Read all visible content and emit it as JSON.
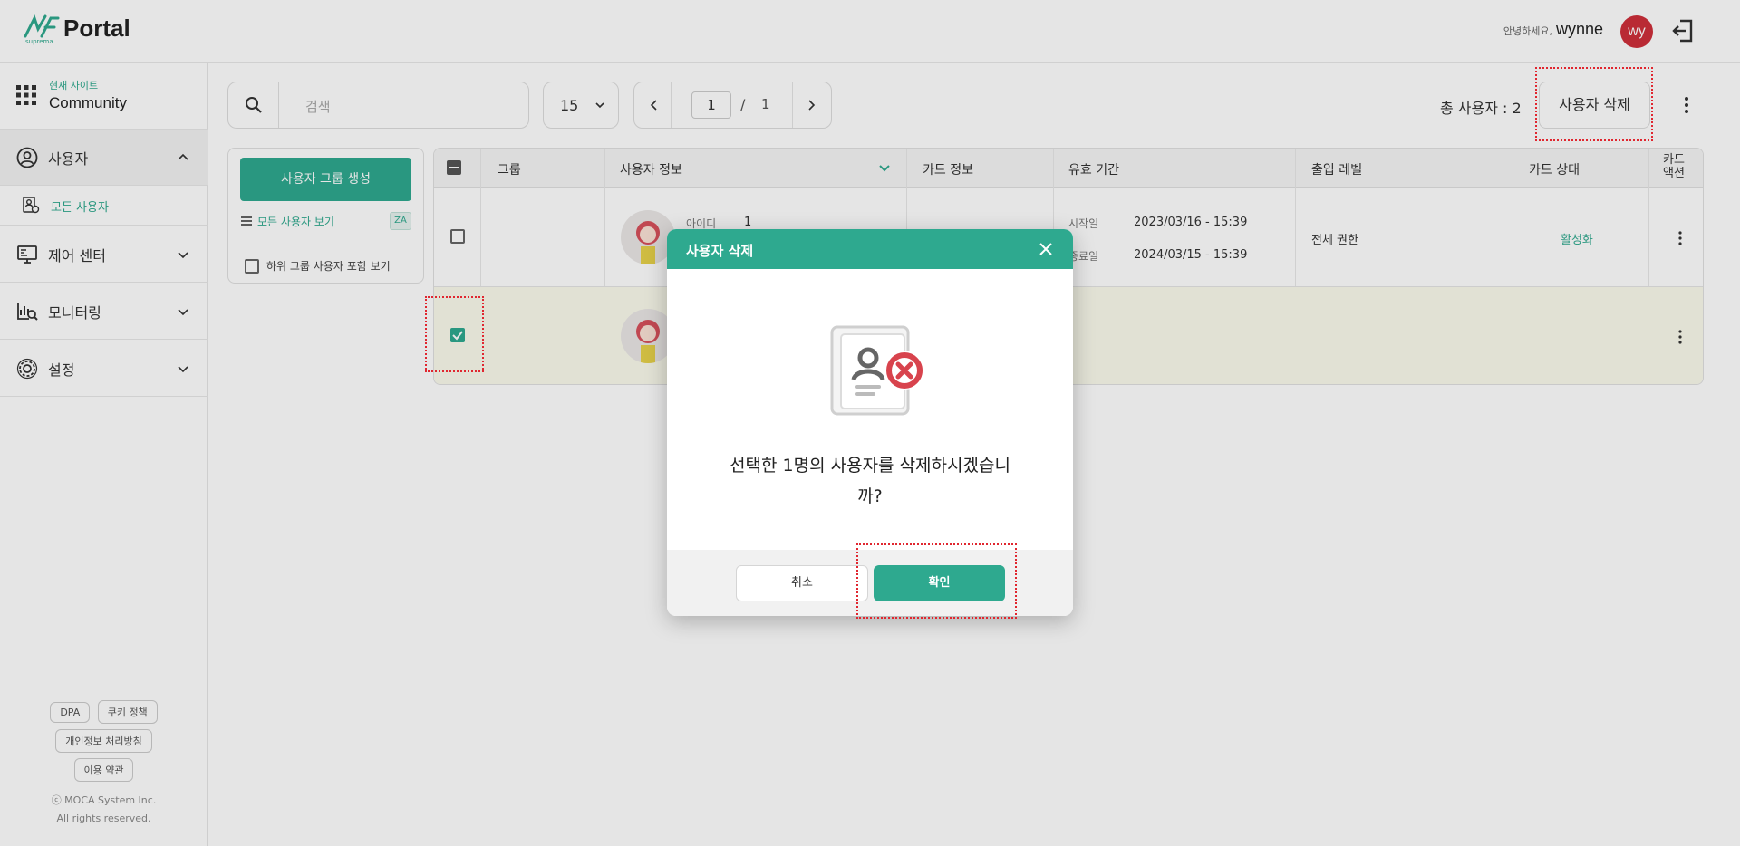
{
  "header": {
    "logo_text": "Portal",
    "logo_sub": "suprema",
    "greeting": "안녕하세요,",
    "username": "wynne",
    "avatar_initials": "wy"
  },
  "sidebar": {
    "site_label": "현재 사이트",
    "site_name": "Community",
    "items": [
      {
        "label": "사용자",
        "icon": "user-circle-icon",
        "expanded": true
      },
      {
        "label": "제어 센터",
        "icon": "control-center-icon"
      },
      {
        "label": "모니터링",
        "icon": "monitoring-icon"
      },
      {
        "label": "설정",
        "icon": "gear-icon"
      }
    ],
    "sub_items": [
      {
        "label": "모든 사용자",
        "icon": "all-users-icon"
      }
    ],
    "footer_links": [
      "DPA",
      "쿠키 정책",
      "개인정보 처리방침",
      "이용 약관"
    ],
    "copyright_1": "ⓒ MOCA System Inc.",
    "copyright_2": "All rights reserved."
  },
  "toolbar": {
    "search_placeholder": "검색",
    "page_size": "15",
    "current_page": "1",
    "page_sep": "/",
    "total_pages": "1",
    "total_users": "총 사용자 : 2",
    "delete_button": "사용자 삭제"
  },
  "group_panel": {
    "create_button": "사용자 그룹 생성",
    "all_users_link": "모든 사용자 보기",
    "sort_label": "ZA",
    "include_subgroups": "하위 그룹 사용자 포함 보기"
  },
  "table": {
    "columns": [
      "그룹",
      "사용자 정보",
      "카드 정보",
      "유효 기간",
      "출입 레벨",
      "카드 상태",
      "카드 액션"
    ],
    "rows": [
      {
        "checked": false,
        "id_label": "아이디",
        "id_value": "1",
        "start_label": "시작일",
        "start_value": "2023/03/16 - 15:39",
        "end_label": "종료일",
        "end_value": "2024/03/15 - 15:39",
        "access_level": "전체 권한",
        "card_status": "활성화"
      },
      {
        "checked": true
      }
    ]
  },
  "modal": {
    "title": "사용자 삭제",
    "message_line1": "선택한 1명의 사용자를 삭제하시겠습니",
    "message_line2": "까?",
    "cancel_button": "취소",
    "confirm_button": "확인"
  },
  "colors": {
    "accent": "#2ea98f",
    "highlight": "#e0262f",
    "avatar_bg": "#cf2f3a"
  }
}
